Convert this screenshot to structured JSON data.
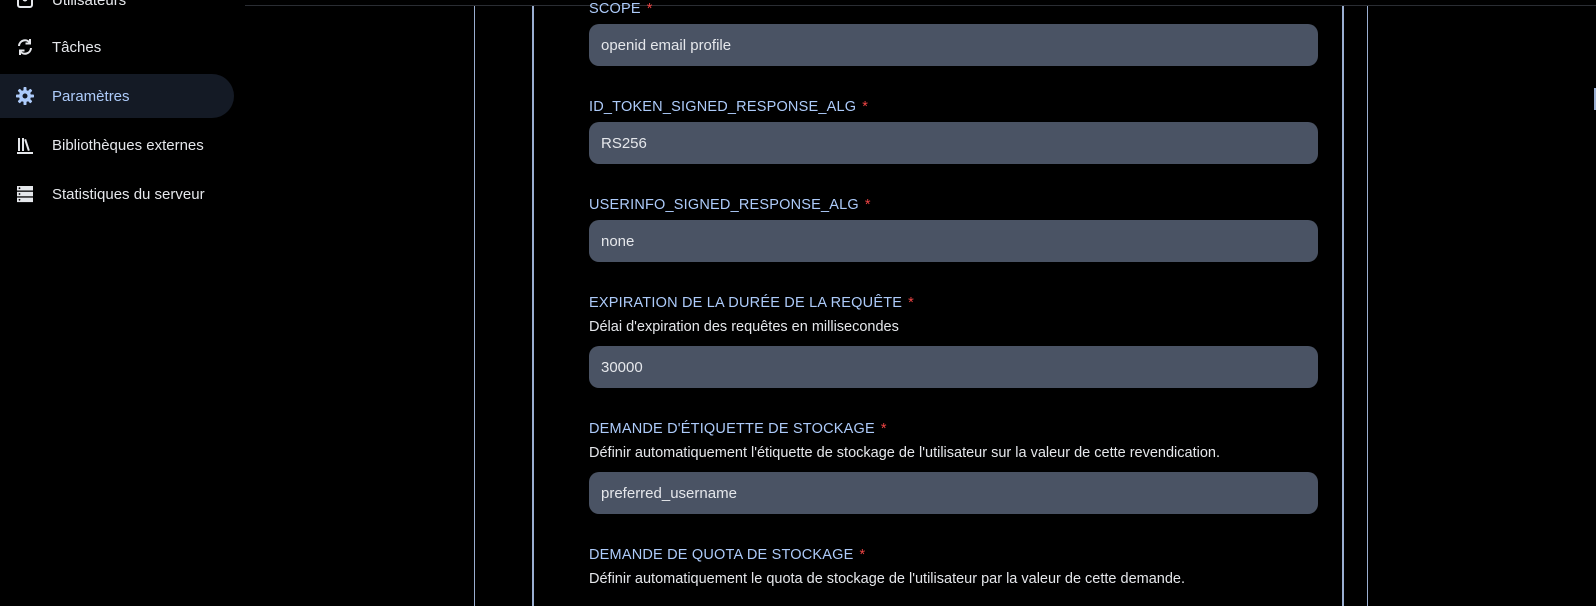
{
  "sidebar": {
    "items": [
      {
        "label": "Utilisateurs",
        "icon": "users-icon",
        "active": false
      },
      {
        "label": "Tâches",
        "icon": "sync-icon",
        "active": false
      },
      {
        "label": "Paramètres",
        "icon": "gear-icon",
        "active": true
      },
      {
        "label": "Bibliothèques externes",
        "icon": "library-icon",
        "active": false
      },
      {
        "label": "Statistiques du serveur",
        "icon": "server-icon",
        "active": false
      }
    ]
  },
  "form": {
    "required_marker": "*",
    "fields": [
      {
        "label": "SCOPE",
        "value": "openid email profile"
      },
      {
        "label": "ID_TOKEN_SIGNED_RESPONSE_ALG",
        "value": "RS256"
      },
      {
        "label": "USERINFO_SIGNED_RESPONSE_ALG",
        "value": "none"
      },
      {
        "label": "EXPIRATION DE LA DURÉE DE LA REQUÊTE",
        "description": "Délai d'expiration des requêtes en millisecondes",
        "value": "30000"
      },
      {
        "label": "DEMANDE D'ÉTIQUETTE DE STOCKAGE",
        "description": "Définir automatiquement l'étiquette de stockage de l'utilisateur sur la valeur de cette revendication.",
        "value": "preferred_username"
      },
      {
        "label": "DEMANDE DE QUOTA DE STOCKAGE",
        "description": "Définir automatiquement le quota de stockage de l'utilisateur par la valeur de cette demande."
      }
    ]
  },
  "colors": {
    "accent": "#adcbfa",
    "required": "#ef4444",
    "input_bg": "#4a5364",
    "active_nav_bg": "#141a25",
    "border": "#9aaed0"
  }
}
